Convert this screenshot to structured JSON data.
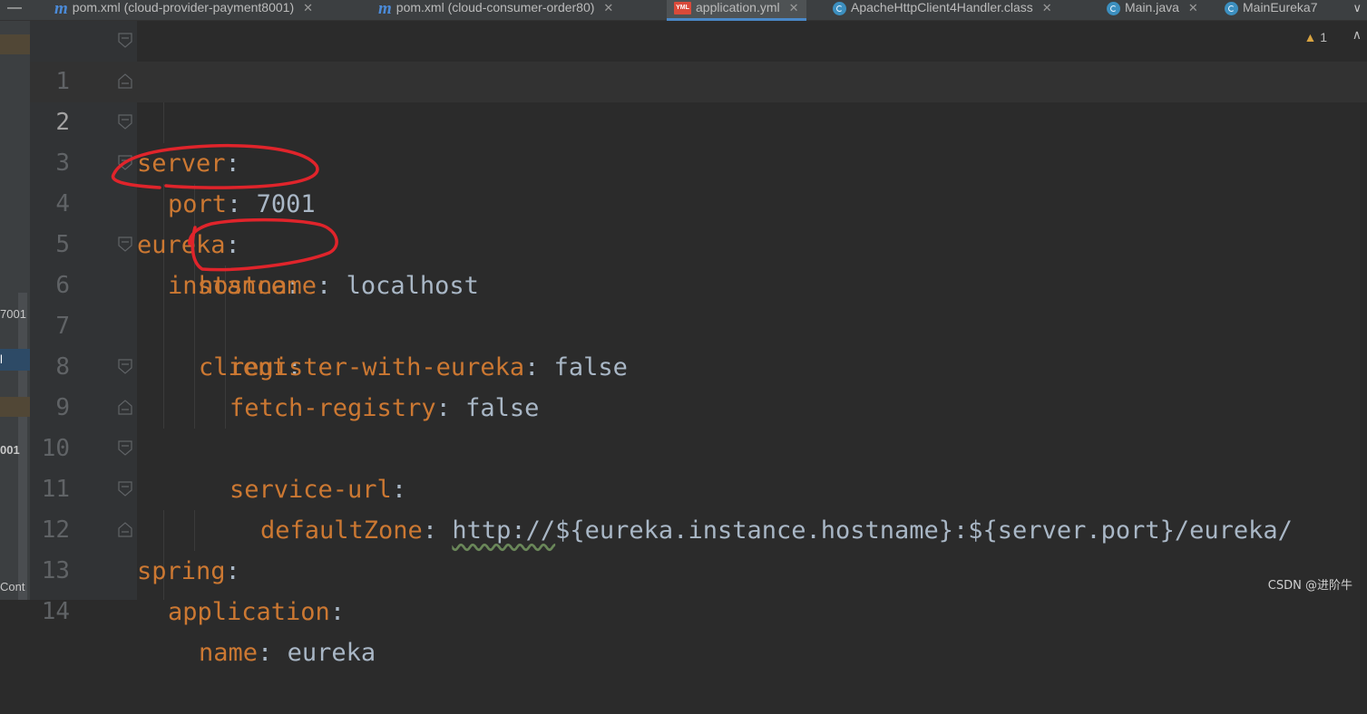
{
  "tabs": [
    {
      "label": "pom.xml (cloud-provider-payment8001)",
      "icon": "maven-icon",
      "active": false
    },
    {
      "label": "pom.xml (cloud-consumer-order80)",
      "icon": "maven-icon",
      "active": false
    },
    {
      "label": "application.yml",
      "icon": "yml-file-icon",
      "active": true
    },
    {
      "label": "ApacheHttpClient4Handler.class",
      "icon": "class-icon",
      "active": false
    },
    {
      "label": "Main.java",
      "icon": "java-class-icon",
      "active": false
    },
    {
      "label": "MainEureka7",
      "icon": "java-class-icon",
      "active": false
    }
  ],
  "tab_strip_button": "—",
  "tab_more": "∨",
  "yml_icon_text": "YML",
  "side_strip": {
    "frag1": "7001",
    "frag2": "l",
    "frag3": "001",
    "frag4": "Cont"
  },
  "editor": {
    "warning_count": "1",
    "warning_icon": "warning-icon",
    "lines": [
      {
        "n": "1",
        "key": "server",
        "value": ""
      },
      {
        "n": "2",
        "key": "port",
        "value": "7001"
      },
      {
        "n": "3",
        "key": "eureka",
        "value": ""
      },
      {
        "n": "4",
        "key": "instance",
        "value": ""
      },
      {
        "n": "5",
        "key": "hostname",
        "value": "localhost"
      },
      {
        "n": "6",
        "key": "client",
        "value": ""
      },
      {
        "n": "7",
        "key": "register-with-eureka",
        "value": "false"
      },
      {
        "n": "8",
        "key": "fetch-registry",
        "value": "false"
      },
      {
        "n": "9",
        "key": "service-url",
        "value": ""
      },
      {
        "n": "10",
        "key": "defaultZone",
        "value_url": "http://",
        "value_rest": "${eureka.instance.hostname}:${server.port}/eureka/"
      },
      {
        "n": "11",
        "key": "spring",
        "value": ""
      },
      {
        "n": "12",
        "key": "application",
        "value": ""
      },
      {
        "n": "13",
        "key": "name",
        "value": "eureka"
      },
      {
        "n": "14",
        "key": "",
        "value": ""
      }
    ],
    "colon": ":"
  },
  "watermark": "CSDN @进阶牛",
  "colors": {
    "key": "#cc7832",
    "value": "#a9b7c6",
    "annotation": "#e0242b",
    "active_tab_border": "#4a88c7"
  }
}
